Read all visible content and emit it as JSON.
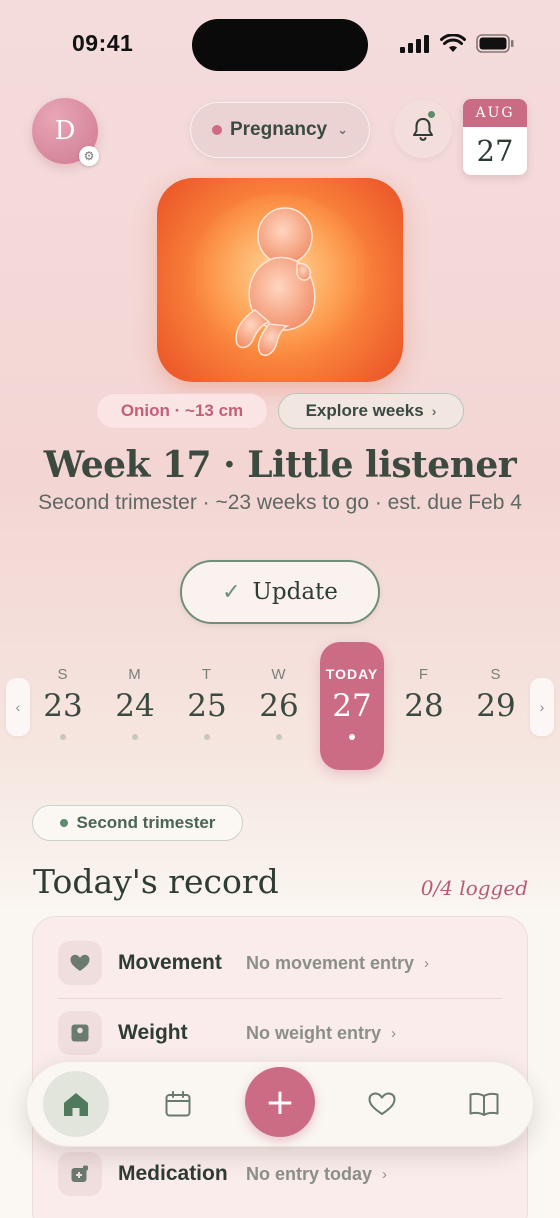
{
  "status_bar": {
    "time": "09:41"
  },
  "header": {
    "avatar_initial": "D",
    "mode_label": "Pregnancy",
    "calendar": {
      "month": "AUG",
      "day": "27"
    }
  },
  "hero": {
    "size_chip": "Onion · ~13 cm",
    "explore_label": "Explore weeks",
    "title": "Week 17 · Little listener",
    "subtitle": "Second trimester · ~23 weeks to go · est. due Feb 4",
    "update_label": "Update"
  },
  "week_strip": {
    "days": [
      {
        "dow": "S",
        "num": "23"
      },
      {
        "dow": "M",
        "num": "24"
      },
      {
        "dow": "T",
        "num": "25"
      },
      {
        "dow": "W",
        "num": "26"
      },
      {
        "dow": "TODAY",
        "num": "27"
      },
      {
        "dow": "F",
        "num": "28"
      },
      {
        "dow": "S",
        "num": "29"
      }
    ]
  },
  "trimester_chip": "Second trimester",
  "record": {
    "title": "Today's record",
    "count": "0/4 logged",
    "rows": [
      {
        "label": "Movement",
        "value": "No movement entry",
        "icon": "heart-icon"
      },
      {
        "label": "Weight",
        "value": "No weight entry",
        "icon": "scale-icon"
      },
      {
        "label": "Medication",
        "value": "No entry today",
        "icon": "pill-icon"
      }
    ]
  },
  "bottom_nav": {
    "items": [
      "home-icon",
      "calendar-icon",
      "plus-icon",
      "heart-icon",
      "book-icon"
    ],
    "plus_glyph": "+"
  },
  "colors": {
    "accent_pink": "#cc6b84",
    "accent_green": "#5f8a6b",
    "text_dark": "#2f3c33"
  }
}
